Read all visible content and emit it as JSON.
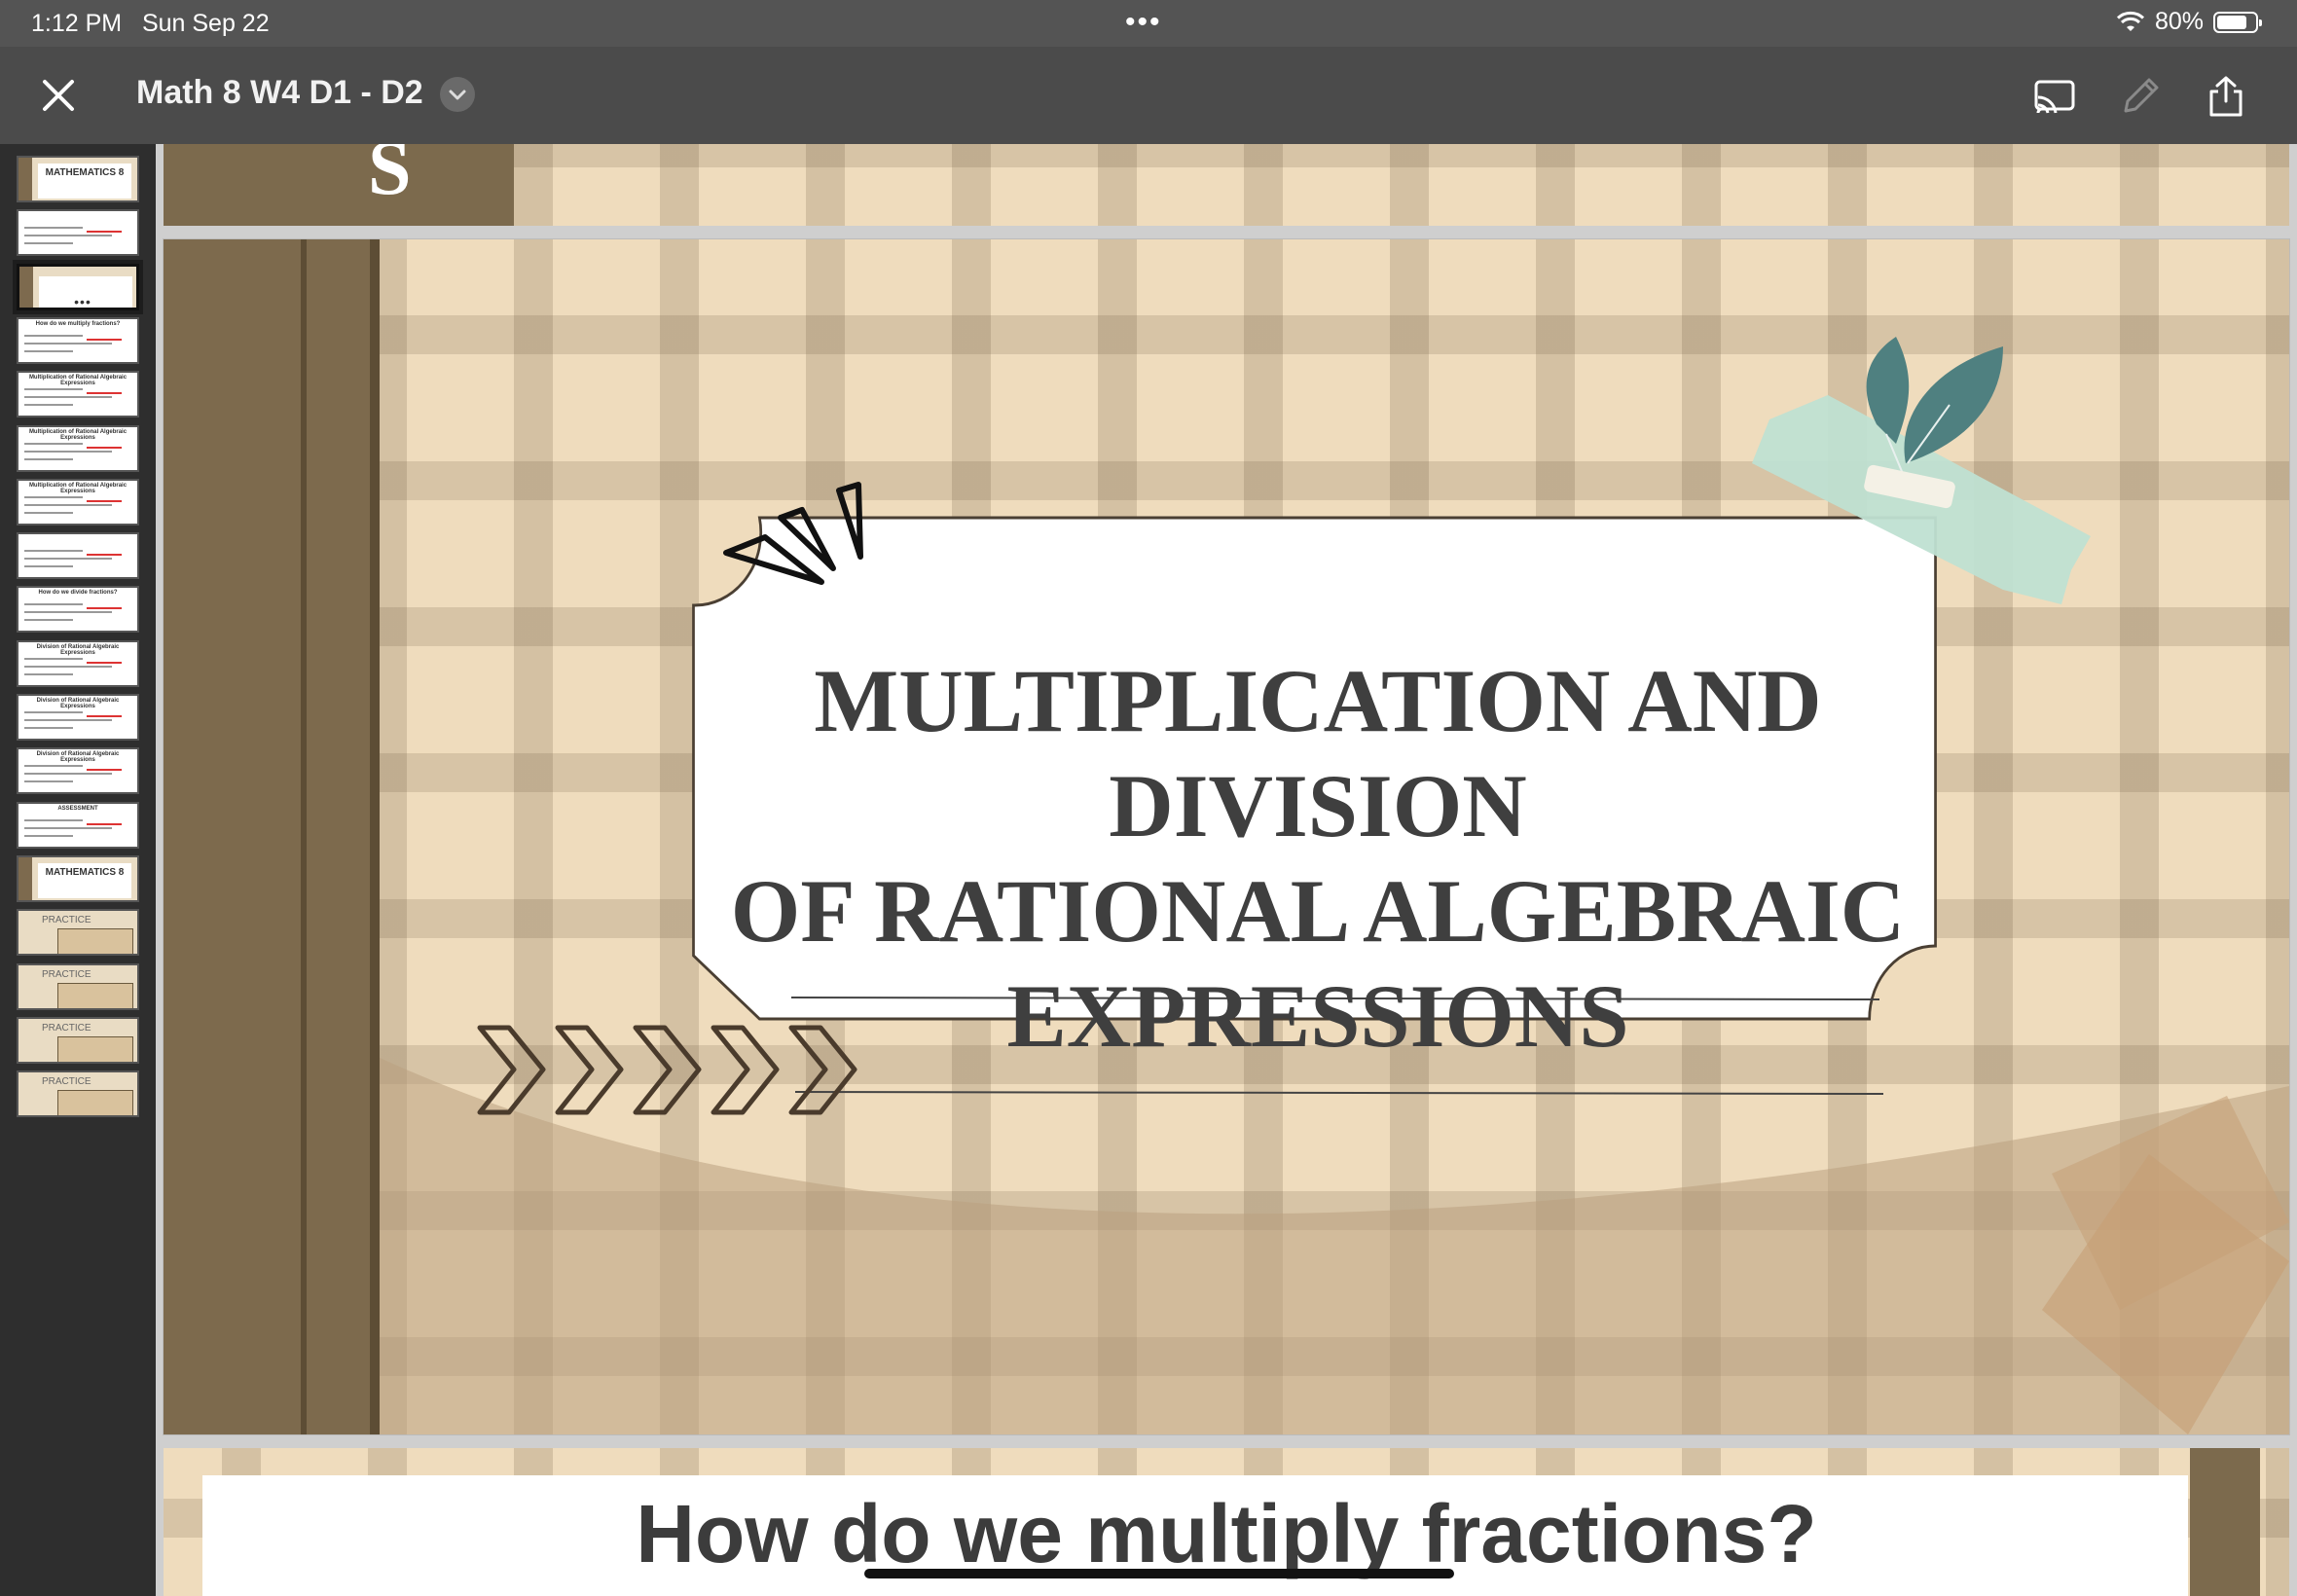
{
  "status_bar": {
    "time": "1:12 PM",
    "date": "Sun Sep 22",
    "battery_text": "80%",
    "battery_level": 0.8
  },
  "toolbar": {
    "document_title": "Math 8 W4 D1 - D2",
    "icons": [
      "close-icon",
      "chevron-down-icon",
      "cast-icon",
      "pencil-icon",
      "share-icon"
    ]
  },
  "thumbnails": {
    "selected_index": 2,
    "items": [
      {
        "title": "MATHEMATICS 8"
      },
      {
        "title": ""
      },
      {
        "title": ""
      },
      {
        "title": "How do we multiply fractions?"
      },
      {
        "title": "Multiplication of Rational Algebraic Expressions"
      },
      {
        "title": "Multiplication of Rational Algebraic Expressions"
      },
      {
        "title": "Multiplication of Rational Algebraic Expressions"
      },
      {
        "title": ""
      },
      {
        "title": "How do we divide fractions?"
      },
      {
        "title": "Division of Rational Algebraic Expressions"
      },
      {
        "title": "Division of Rational Algebraic Expressions"
      },
      {
        "title": "Division of Rational Algebraic Expressions"
      },
      {
        "title": "ASSESSMENT"
      },
      {
        "title": "MATHEMATICS 8"
      },
      {
        "title": "PRACTICE"
      },
      {
        "title": "PRACTICE"
      },
      {
        "title": "PRACTICE"
      },
      {
        "title": "PRACTICE"
      }
    ]
  },
  "slides": {
    "previous_partial_letter": "S",
    "current_title_lines": [
      "MULTIPLICATION AND DIVISION",
      "OF RATIONAL ALGEBRAIC",
      "EXPRESSIONS"
    ],
    "next_title": "How do we multiply fractions?"
  },
  "colors": {
    "band_brown": "#7d6a4d",
    "plaid_base": "#efdcbd",
    "leaf_teal": "#4f8080",
    "tape_mint": "#bfe0d2",
    "text_dark": "#3f3f3f"
  }
}
